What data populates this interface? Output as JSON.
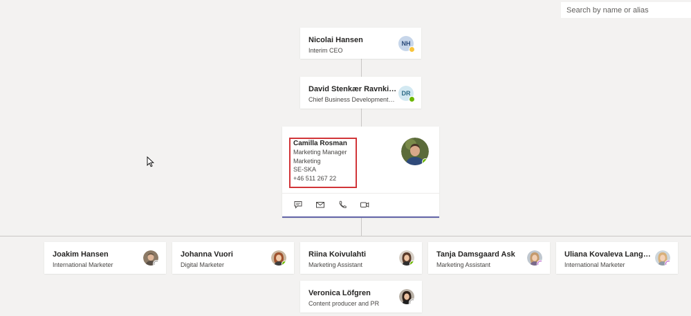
{
  "search": {
    "placeholder": "Search by name or alias"
  },
  "managers": [
    {
      "name": "Nicolai Hansen",
      "title": "Interim CEO",
      "initials": "NH",
      "presence": "away"
    },
    {
      "name": "David Stenkær Ravnkilde",
      "title": "Chief Business Development ...",
      "initials": "DR",
      "presence": "available"
    }
  ],
  "focused": {
    "name": "Camilla Rosman",
    "job_title": "Marketing Manager",
    "department": "Marketing",
    "office": "SE-SKA",
    "phone": "+46 511 267 22",
    "presence": "available",
    "actions": [
      "chat-icon",
      "mail-icon",
      "phone-icon",
      "video-icon"
    ]
  },
  "reports": [
    {
      "name": "Joakim Hansen",
      "title": "International Marketer",
      "presence": "offline"
    },
    {
      "name": "Johanna Vuori",
      "title": "Digital Marketer",
      "presence": "available"
    },
    {
      "name": "Riina Koivulahti",
      "title": "Marketing Assistant",
      "presence": "available"
    },
    {
      "name": "Tanja Damsgaard Ask",
      "title": "Marketing Assistant",
      "presence": "dnd-out"
    },
    {
      "name": "Uliana Kovaleva Langel...",
      "title": "International Marketer",
      "presence": "dnd-out"
    },
    {
      "name": "Veronica Löfgren",
      "title": "Content producer and PR",
      "presence": "offline"
    }
  ],
  "colors": {
    "accent": "#6264a7",
    "highlight": "#d13438",
    "background": "#f3f2f1"
  }
}
